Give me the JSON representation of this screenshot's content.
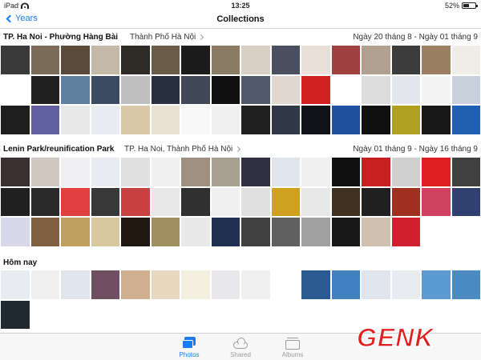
{
  "status": {
    "device": "iPad",
    "time": "13:25",
    "battery": "52%",
    "battery_level": 0.52
  },
  "nav": {
    "back_label": "Years",
    "title": "Collections"
  },
  "sections": [
    {
      "title": "TP. Ha Noi - Phường Hàng Bài",
      "location": "Thành Phố Hà Nội",
      "dates": "Ngày 20 tháng 8 - Ngày 01 tháng 9",
      "tiles": [
        "#3a3a3a",
        "#7a6a58",
        "#5a4a3a",
        "#c4b8a8",
        "#2e2a24",
        "#6b5b49",
        "#1c1c1c",
        "#8a7c64",
        "#d8d0c4",
        "#4a5060",
        "#e8e0d8",
        "#a04040",
        "#b0a090",
        "#3c3c3c",
        "#9a8060",
        "#f0ece8",
        "#ffffff",
        "#202020",
        "#6080a0",
        "#3a4a60",
        "#c0c0c0",
        "#283040",
        "#404858",
        "#101010",
        "#505a6a",
        "#e0d8d0",
        "#d02020",
        "#ffffff",
        "#dcdcdc",
        "#e4e8ec",
        "#f4f4f4",
        "#c8d0dc",
        "#1e1e1e",
        "#6060a0",
        "#e8e8e8",
        "#e8ecf0",
        "#d8c8a8",
        "#e8e0d0",
        "#f8f8f8",
        "#f0f0f0",
        "#202020",
        "#303848",
        "#101418",
        "#2050a0",
        "#101010",
        "#b0a020",
        "#181818",
        "#2060b0"
      ]
    },
    {
      "title": "Lenin Park/reunification Park",
      "location": "TP. Ha Noi, Thành Phố Hà Nội",
      "dates": "Ngày 01 tháng 9 - Ngày 16 tháng 9",
      "tiles": [
        "#3a3030",
        "#d0c8c0",
        "#f0f0f4",
        "#e8ecf0",
        "#e0e0e0",
        "#f0f0f0",
        "#a09080",
        "#a8a090",
        "#303040",
        "#e0e4ec",
        "#f0f0f0",
        "#101010",
        "#c82020",
        "#d0d0d0",
        "#e02020",
        "#404040",
        "#202020",
        "#2a2a2a",
        "#e04040",
        "#383838",
        "#c84040",
        "#e8e8e8",
        "#303030",
        "#f0f0f0",
        "#e0e0e0",
        "#d0a020",
        "#e8e8e8",
        "#403020",
        "#202020",
        "#a03020",
        "#d04060",
        "#304070",
        "#d8d8e8",
        "#806040",
        "#c0a060",
        "#d8c8a0",
        "#201810",
        "#a09060",
        "#e8e8e8",
        "#203050",
        "#404040",
        "#606060",
        "#a0a0a0",
        "#181818",
        "#d0c0b0",
        "#d02030",
        "#ffffff",
        "#ffffff"
      ]
    },
    {
      "title": "Hôm nay",
      "tiles": [
        "#e8ecf0",
        "#f0f0f0",
        "#e0e4ec",
        "#705060",
        "#d0b090",
        "#e8d8c0",
        "#f4f0e0",
        "#e8e8ec",
        "#f0f0f0",
        "#ffffff",
        "#2a5a90",
        "#4080c0",
        "#e0e4ec",
        "#e8ecf0",
        "#5a9ad0",
        "#4a8ac0",
        "#202830"
      ]
    }
  ],
  "tabs": [
    {
      "label": "Photos",
      "active": true
    },
    {
      "label": "Shared",
      "active": false
    },
    {
      "label": "Albums",
      "active": false
    }
  ],
  "watermark": {
    "text": "GENK"
  }
}
